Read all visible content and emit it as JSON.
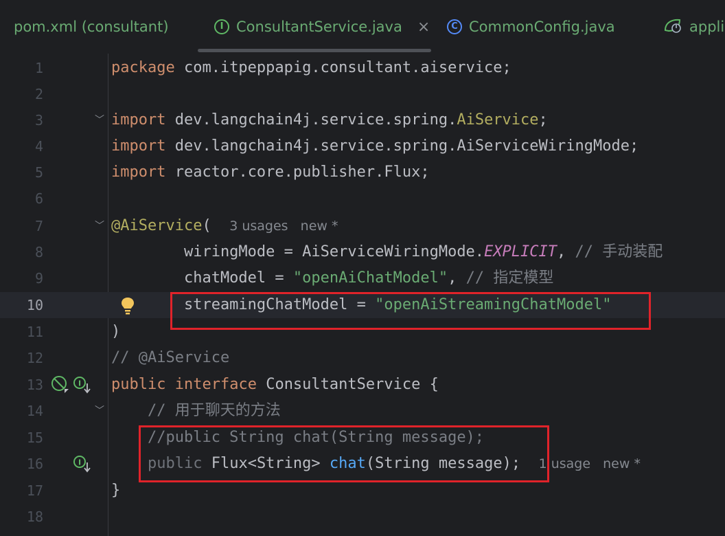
{
  "tabs": [
    {
      "label": "pom.xml (consultant)"
    },
    {
      "label": "ConsultantService.java",
      "icon": "interface-icon",
      "icon_glyph": "I",
      "close": "×"
    },
    {
      "label": "CommonConfig.java",
      "icon": "class-icon",
      "icon_glyph": "C"
    },
    {
      "label": "applic",
      "icon": "spring-app-icon"
    }
  ],
  "editor": {
    "current_line": 10,
    "lines": [
      {
        "n": "1"
      },
      {
        "n": "2"
      },
      {
        "n": "3"
      },
      {
        "n": "4"
      },
      {
        "n": "5"
      },
      {
        "n": "6"
      },
      {
        "n": "7"
      },
      {
        "n": "8"
      },
      {
        "n": "9"
      },
      {
        "n": "10"
      },
      {
        "n": "11"
      },
      {
        "n": "12"
      },
      {
        "n": "13"
      },
      {
        "n": "14"
      },
      {
        "n": "15"
      },
      {
        "n": "16"
      },
      {
        "n": "17"
      },
      {
        "n": "18"
      }
    ],
    "code": {
      "l1_kw": "package",
      "l1_rest": " com.itpeppapig.consultant.aiservice;",
      "l3_kw": "import",
      "l3_rest": " dev.langchain4j.service.spring.",
      "l3_cls": "AiService",
      "l3_end": ";",
      "l4_kw": "import",
      "l4_rest": " dev.langchain4j.service.spring.AiServiceWiringMode;",
      "l5_kw": "import",
      "l5_rest": " reactor.core.publisher.Flux;",
      "l7_ann": "@AiService",
      "l7_paren": "(",
      "l7_hint": "3 usages   new *",
      "l8_a": "        wiringMode = AiServiceWiringMode.",
      "l8_const": "EXPLICIT",
      "l8_b": ", ",
      "l8_cmt": "// 手动装配",
      "l9_a": "        chatModel = ",
      "l9_str": "\"openAiChatModel\"",
      "l9_b": ", ",
      "l9_cmt": "// 指定模型",
      "l10_a": "        streamingChatModel = ",
      "l10_str": "\"openAiStreamingChatModel\"",
      "l11": ")",
      "l12": "// @AiService",
      "l13_kw1": "public",
      "l13_kw2": "interface",
      "l13_rest": " ConsultantService {",
      "l14": "    // 用于聊天的方法",
      "l15": "    //public String chat(String message);",
      "l16_kw": "public",
      "l16_a": " Flux<String> ",
      "l16_meth": "chat",
      "l16_b": "(String message);",
      "l16_hint": "1 usage   new *",
      "l17": "}"
    }
  },
  "colors": {
    "highlight_box": "#e0232a",
    "keyword": "#cf8e6d",
    "string": "#6aab73",
    "comment": "#7a7e85"
  }
}
